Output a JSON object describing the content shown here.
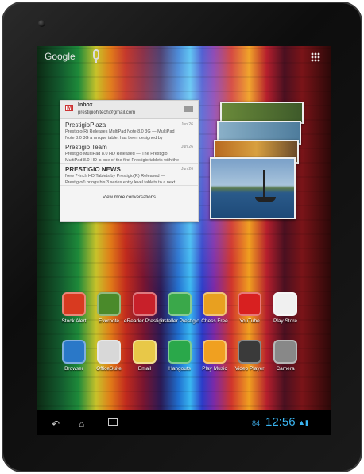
{
  "search_bar": {
    "label": "Google"
  },
  "gmail_widget": {
    "title": "Inbox",
    "account": "prestigiohitech@gmail.com",
    "messages": [
      {
        "from": "PrestigioPlaza",
        "date": "Jun 26",
        "snippet1": "Prestigio(R) Releases MultiPad Note 8.0 3G — MultiPad",
        "snippet2": "Note 8.0 3G a unique tablet has been designed by"
      },
      {
        "from": "Prestigio Team",
        "date": "Jun 26",
        "snippet1": "Prestigio MultiPad 8.0 HD Released — The Prestigio",
        "snippet2": "MultiPad 8.0 HD is one of the first Prestigio tablets with the"
      },
      {
        "from": "PRESTIGIO NEWS",
        "date": "Jun 26",
        "snippet1": "New 7-inch HD Tablets by Prestigio(R) Released —",
        "snippet2": "Prestigio® brings his 3 series entry level tablets to a next"
      }
    ],
    "more_label": "View more conversations"
  },
  "apps": [
    {
      "label": "Stock Alert",
      "icon": "stock-alert-icon",
      "color": "#d83a20"
    },
    {
      "label": "Evernote",
      "icon": "evernote-icon",
      "color": "#4a8a2a"
    },
    {
      "label": "eReader Prestigio",
      "icon": "ereader-icon",
      "color": "#c8202a"
    },
    {
      "label": "Installer Prestigio",
      "icon": "installer-icon",
      "color": "#3aa84a"
    },
    {
      "label": "Chess Free",
      "icon": "chess-icon",
      "color": "#e8a020"
    },
    {
      "label": "YouTube",
      "icon": "youtube-icon",
      "color": "#d82020"
    },
    {
      "label": "Play Store",
      "icon": "play-store-icon",
      "color": "#f0f0f0"
    },
    {
      "label": "Browser",
      "icon": "browser-icon",
      "color": "#2a78c8"
    },
    {
      "label": "OfficeSuite",
      "icon": "officesuite-icon",
      "color": "#d8d8d8"
    },
    {
      "label": "Email",
      "icon": "email-icon",
      "color": "#e8c848"
    },
    {
      "label": "Hangouts",
      "icon": "hangouts-icon",
      "color": "#2aa84a"
    },
    {
      "label": "Play Music",
      "icon": "play-music-icon",
      "color": "#f0a020"
    },
    {
      "label": "Video Player",
      "icon": "video-player-icon",
      "color": "#3a3a3a"
    },
    {
      "label": "Camera",
      "icon": "camera-icon",
      "color": "#888888"
    }
  ],
  "status": {
    "battery": "84",
    "time": "12:56"
  }
}
